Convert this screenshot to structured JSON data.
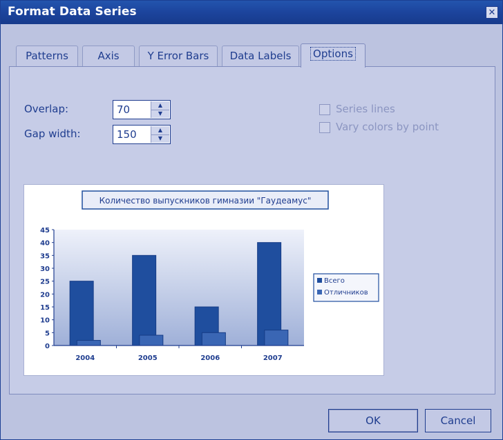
{
  "dialog": {
    "title": "Format Data Series",
    "close_glyph": "✕"
  },
  "tabs": [
    {
      "label": "Patterns",
      "active": false
    },
    {
      "label": "Axis",
      "active": false
    },
    {
      "label": "Y Error Bars",
      "active": false
    },
    {
      "label": "Data Labels",
      "active": false
    },
    {
      "label": "Options",
      "active": true
    }
  ],
  "options": {
    "overlap": {
      "label": "Overlap:",
      "value": "70"
    },
    "gap_width": {
      "label": "Gap width:",
      "value": "150"
    },
    "series_lines": {
      "label": "Series lines",
      "checked": false,
      "enabled": false
    },
    "vary_colors": {
      "label": "Vary colors by point",
      "checked": false,
      "enabled": false
    }
  },
  "buttons": {
    "ok": "OK",
    "cancel": "Cancel"
  },
  "chart_data": {
    "type": "bar",
    "title": "Количество выпускников гимназии \"Гаудеамус\"",
    "categories": [
      "2004",
      "2005",
      "2006",
      "2007"
    ],
    "series": [
      {
        "name": "Всего",
        "values": [
          25,
          35,
          15,
          40
        ]
      },
      {
        "name": "Отличников",
        "values": [
          2,
          4,
          5,
          6
        ]
      }
    ],
    "ylim": [
      0,
      45
    ],
    "yticks": [
      "0",
      "5",
      "10",
      "15",
      "20",
      "25",
      "30",
      "35",
      "40",
      "45"
    ],
    "legend_position": "right",
    "colors": {
      "bar": "#1f4e9e",
      "plot_bg_top": "#eef1fa",
      "plot_bg_bottom": "#9fb0d8"
    }
  }
}
